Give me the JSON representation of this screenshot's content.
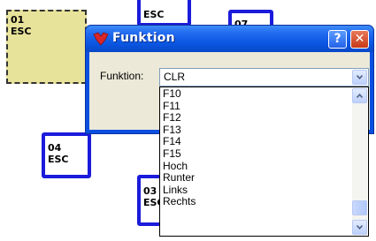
{
  "background_keys": [
    {
      "num": "01",
      "label": "ESC",
      "selected": true
    },
    {
      "num": "",
      "label": "ESC"
    },
    {
      "num": "07",
      "label": ""
    },
    {
      "num": "04",
      "label": "ESC"
    },
    {
      "num": "03",
      "label": "ESC"
    }
  ],
  "dialog": {
    "title": "Funktion",
    "help_glyph": "?",
    "close_glyph": "✕",
    "field_label": "Funktion:",
    "combo_value": "CLR"
  },
  "dropdown": {
    "items": [
      "F10",
      "F11",
      "F12",
      "F13",
      "F14",
      "F15",
      "Hoch",
      "Runter",
      "Links",
      "Rechts"
    ]
  },
  "colors": {
    "key_border": "#1b1bdb",
    "selected_key_fill": "#e8e39a",
    "titlebar": "#0a55e0",
    "dialog_face": "#ece9d8"
  }
}
